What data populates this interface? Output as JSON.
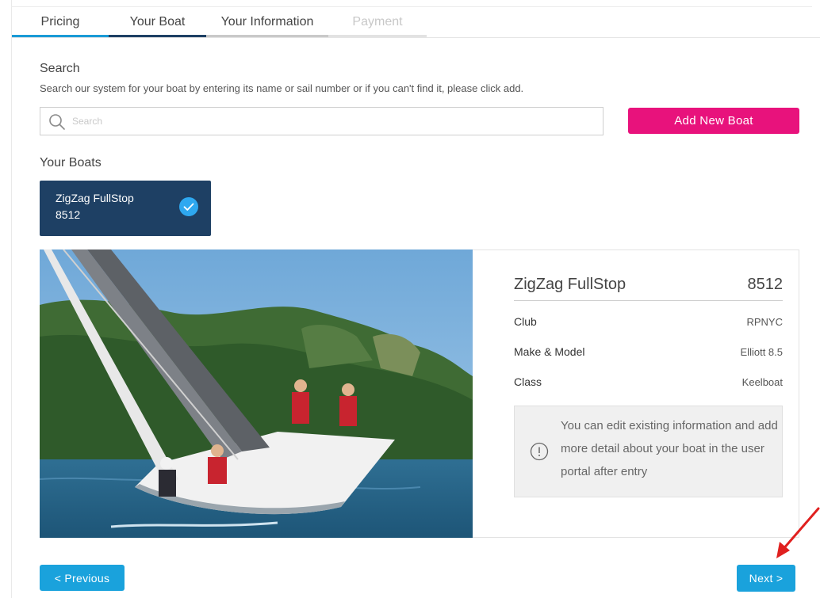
{
  "tabs": [
    {
      "label": "Pricing",
      "state": "complete"
    },
    {
      "label": "Your Boat",
      "state": "active"
    },
    {
      "label": "Your Information",
      "state": "pending"
    },
    {
      "label": "Payment",
      "state": "disabled"
    }
  ],
  "search": {
    "title": "Search",
    "help": "Search our system for your boat by entering its name or sail number or if you can't find it, please click add.",
    "placeholder": "Search",
    "value": ""
  },
  "add_button": "Add New Boat",
  "boats": {
    "title": "Your Boats",
    "selected": {
      "name": "ZigZag FullStop",
      "sail": "8512"
    }
  },
  "details": {
    "name": "ZigZag FullStop",
    "sail": "8512",
    "rows": [
      {
        "label": "Club",
        "value": "RPNYC"
      },
      {
        "label": "Make & Model",
        "value": "Elliott 8.5"
      },
      {
        "label": "Class",
        "value": "Keelboat"
      }
    ],
    "note": "You can edit existing information and add more detail about your boat in the user portal after entry",
    "note_icon": "info-icon"
  },
  "nav": {
    "previous": "< Previous",
    "next": "Next >"
  },
  "colors": {
    "accent_pink": "#e8127c",
    "accent_blue": "#1aa2dc",
    "navy": "#1e4064",
    "annotation_arrow": "#e0201f"
  }
}
